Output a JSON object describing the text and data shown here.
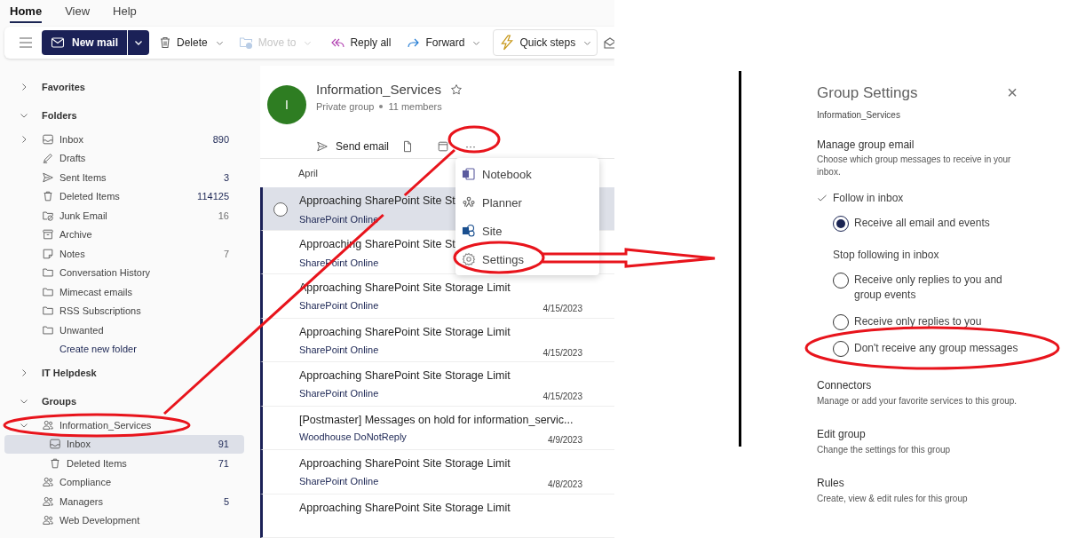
{
  "ribbon_tabs": [
    {
      "label": "Home",
      "selected": true
    },
    {
      "label": "View",
      "selected": false
    },
    {
      "label": "Help",
      "selected": false
    }
  ],
  "toolbar": {
    "new_mail": "New mail",
    "items": [
      {
        "kind": "delete",
        "label": "Delete",
        "disabled": false,
        "dropdown": true
      },
      {
        "kind": "move",
        "label": "Move to",
        "disabled": true,
        "dropdown": true
      },
      {
        "kind": "separator"
      },
      {
        "kind": "reply_all",
        "label": "Reply all",
        "disabled": false,
        "dropdown": false
      },
      {
        "kind": "forward",
        "label": "Forward",
        "disabled": false,
        "dropdown": true
      },
      {
        "kind": "separator"
      },
      {
        "kind": "quick_steps",
        "label": "Quick steps",
        "disabled": false,
        "dropdown": true
      },
      {
        "kind": "read"
      }
    ]
  },
  "sidebar": {
    "sections": [
      {
        "label": "Favorites",
        "expanded": false
      },
      {
        "label": "Folders",
        "expanded": true,
        "children": [
          {
            "kind": "inbox",
            "label": "Inbox",
            "count": "890",
            "expanded": false,
            "selected": false
          },
          {
            "kind": "drafts",
            "label": "Drafts",
            "selected": false
          },
          {
            "kind": "sent",
            "label": "Sent Items",
            "count": "3",
            "selected": false
          },
          {
            "kind": "deleted",
            "label": "Deleted Items",
            "count": "114125",
            "selected": false
          },
          {
            "kind": "junk",
            "label": "Junk Email",
            "count": "16",
            "selected": false
          },
          {
            "kind": "archive",
            "label": "Archive",
            "selected": false
          },
          {
            "kind": "notes",
            "label": "Notes",
            "count": "7",
            "selected": false
          },
          {
            "kind": "folder",
            "label": "Conversation History",
            "selected": false
          },
          {
            "kind": "folder",
            "label": "Mimecast emails",
            "selected": false
          },
          {
            "kind": "folder",
            "label": "RSS Subscriptions",
            "selected": false
          },
          {
            "kind": "folder",
            "label": "Unwanted",
            "selected": false
          },
          {
            "kind": "link",
            "label": "Create new folder"
          }
        ]
      },
      {
        "label": "IT Helpdesk",
        "expanded": false
      },
      {
        "label": "Groups",
        "expanded": true,
        "children": [
          {
            "kind": "group",
            "label": "Information_Services",
            "expanded": true,
            "selected": false,
            "children": [
              {
                "kind": "inbox",
                "label": "Inbox",
                "count": "91",
                "selected": true
              },
              {
                "kind": "deleted",
                "label": "Deleted Items",
                "count": "71",
                "selected": false
              }
            ]
          },
          {
            "kind": "group",
            "label": "Compliance",
            "selected": false
          },
          {
            "kind": "group",
            "label": "Managers",
            "count": "5",
            "selected": false
          },
          {
            "kind": "group",
            "label": "Web Development",
            "selected": false
          }
        ]
      }
    ]
  },
  "group_header": {
    "initial": "I",
    "name": "Information_Services",
    "privacy": "Private group",
    "members": "11 members",
    "send_email": "Send email",
    "more": "···"
  },
  "more_menu": [
    {
      "kind": "notebook",
      "label": "Notebook"
    },
    {
      "kind": "planner",
      "label": "Planner"
    },
    {
      "kind": "site",
      "label": "Site"
    },
    {
      "kind": "settings",
      "label": "Settings"
    }
  ],
  "messages": {
    "date_group": "April",
    "rows": [
      {
        "subject": "Approaching SharePoint Site St",
        "sender": "SharePoint Online",
        "selected": true,
        "unread": true
      },
      {
        "subject": "Approaching SharePoint Site St",
        "sender": "SharePoint Online",
        "selected": false,
        "unread": true
      },
      {
        "subject": "Approaching SharePoint Site Storage Limit",
        "sender": "SharePoint Online",
        "date": "4/15/2023",
        "selected": false,
        "unread": true
      },
      {
        "subject": "Approaching SharePoint Site Storage Limit",
        "sender": "SharePoint Online",
        "date": "4/15/2023",
        "selected": false,
        "unread": true
      },
      {
        "subject": "Approaching SharePoint Site Storage Limit",
        "sender": "SharePoint Online",
        "date": "4/15/2023",
        "selected": false,
        "unread": true
      },
      {
        "subject": "[Postmaster] Messages on hold for information_servic...",
        "sender": "Woodhouse DoNotReply",
        "date": "4/9/2023",
        "selected": false,
        "unread": true
      },
      {
        "subject": "Approaching SharePoint Site Storage Limit",
        "sender": "SharePoint Online",
        "date": "4/8/2023",
        "selected": false,
        "unread": true
      },
      {
        "subject": "Approaching SharePoint Site Storage Limit",
        "selected": false,
        "unread": true
      }
    ]
  },
  "settings_panel": {
    "title": "Group Settings",
    "close": "×",
    "group": "Information_Services",
    "manage": {
      "heading": "Manage group email",
      "description": "Choose which group messages to receive in your inbox.",
      "modes": [
        {
          "label": "Follow in inbox",
          "checked": true,
          "options": [
            {
              "label": "Receive all email and events",
              "selected": true
            }
          ]
        },
        {
          "label": "Stop following in inbox",
          "checked": false,
          "options": [
            {
              "label": "Receive only replies to you and group events",
              "selected": false
            },
            {
              "label": "Receive only replies to you",
              "selected": false
            },
            {
              "label": "Don't receive any group messages",
              "selected": false
            }
          ]
        }
      ]
    },
    "links": [
      {
        "title": "Connectors",
        "description": "Manage or add your favorite services to this group."
      },
      {
        "title": "Edit group",
        "description": "Change the settings for this group"
      },
      {
        "title": "Rules",
        "description": "Create, view & edit rules for this group"
      }
    ]
  }
}
